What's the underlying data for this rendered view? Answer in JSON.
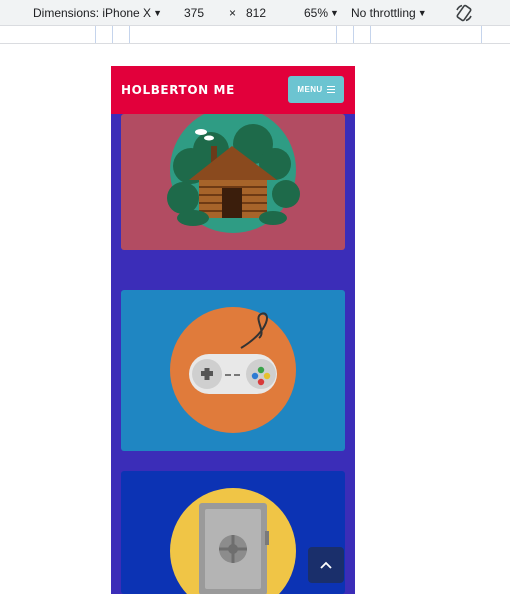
{
  "devtools": {
    "dimensions_label": "Dimensions: iPhone X",
    "width": "375",
    "times": "×",
    "height": "812",
    "zoom": "65%",
    "throttling": "No throttling",
    "rotate_icon": "rotate-icon"
  },
  "site": {
    "brand": "HOLBERTON ME",
    "menu_label": "MENU",
    "cards": [
      {
        "icon": "log-cabin-icon",
        "color": "#b24c62"
      },
      {
        "icon": "gamepad-icon",
        "color": "#1f86c2"
      },
      {
        "icon": "safe-icon",
        "color": "#0c33b4"
      }
    ],
    "back_to_top_icon": "chevron-up-icon"
  },
  "colors": {
    "header": "#e2003b",
    "menu_button": "#6cc4d1",
    "page_background": "#3b2db8",
    "back_to_top": "#1a2f6b"
  }
}
